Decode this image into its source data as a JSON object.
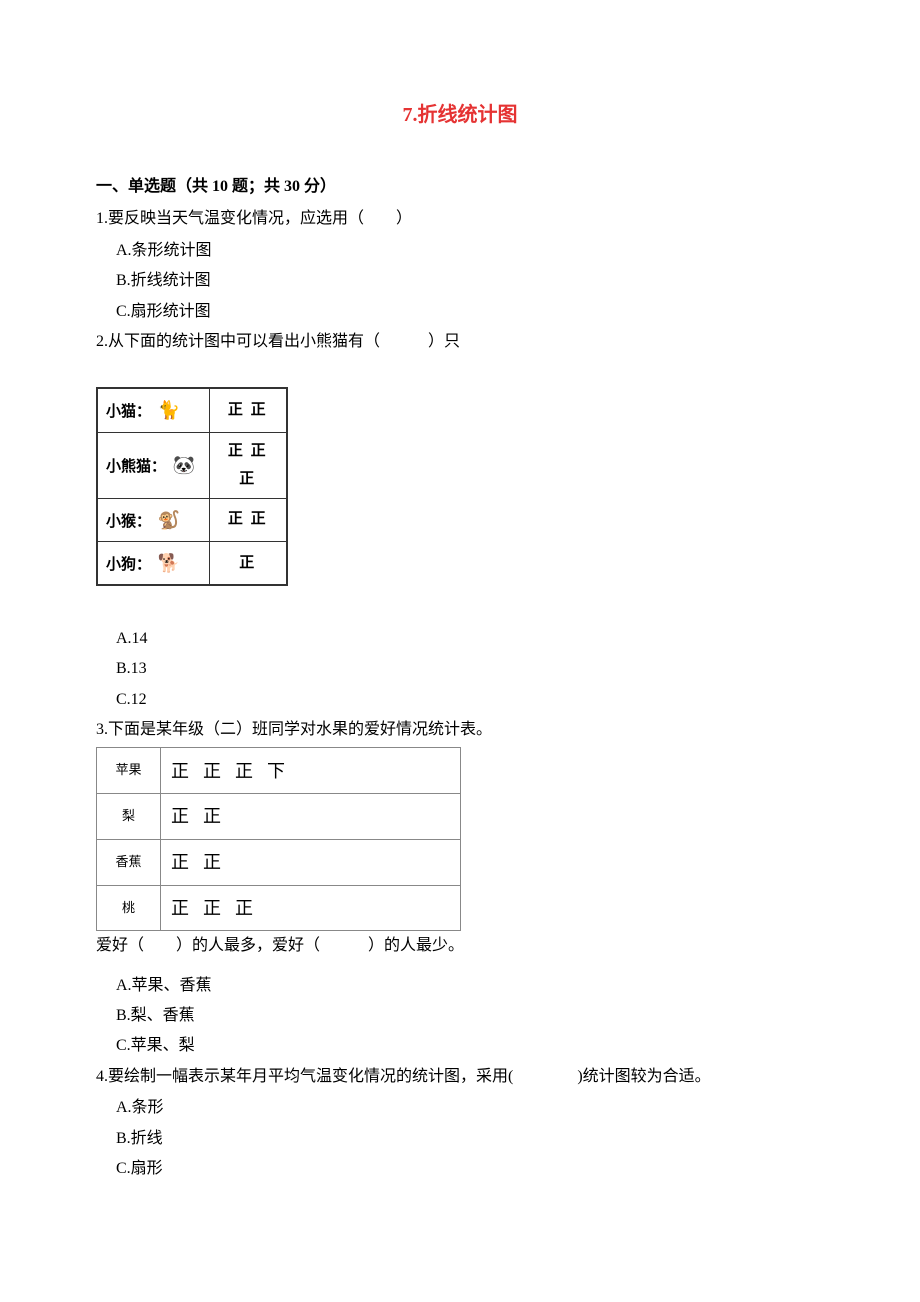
{
  "title": "7.折线统计图",
  "section1": {
    "header": "一、单选题（共 10 题；共 30 分）"
  },
  "q1": {
    "stem": "1.要反映当天气温变化情况，应选用（　　）",
    "A": "A.条形统计图",
    "B": "B.折线统计图",
    "C": "C.扇形统计图"
  },
  "q2": {
    "stem": "2.从下面的统计图中可以看出小熊猫有（　　　）只",
    "table": {
      "rows": [
        {
          "label": "小猫：",
          "icon": "cat-icon",
          "tally": "正 正"
        },
        {
          "label": "小熊猫：",
          "icon": "panda-icon",
          "tally": "正 正 正"
        },
        {
          "label": "小猴：",
          "icon": "monkey-icon",
          "tally": "正 正"
        },
        {
          "label": "小狗：",
          "icon": "dog-icon",
          "tally": "正"
        }
      ]
    },
    "A": "A.14",
    "B": "B.13",
    "C": "C.12"
  },
  "q3": {
    "stem": "3.下面是某年级（二）班同学对水果的爱好情况统计表。",
    "table": {
      "rows": [
        {
          "label": "苹果",
          "tally": "正正正下"
        },
        {
          "label": "梨",
          "tally": "正正"
        },
        {
          "label": "香蕉",
          "tally": "正正"
        },
        {
          "label": "桃",
          "tally": "正正正"
        }
      ]
    },
    "followup_a": "爱好（　　）的人最多，爱好（　　　）的人最少。",
    "A": "A.苹果、香蕉",
    "B": "B.梨、香蕉",
    "C": "C.苹果、梨"
  },
  "q4": {
    "stem": "4.要绘制一幅表示某年月平均气温变化情况的统计图，采用(　　　　)统计图较为合适。",
    "A": "A.条形",
    "B": "B.折线",
    "C": "C.扇形"
  }
}
